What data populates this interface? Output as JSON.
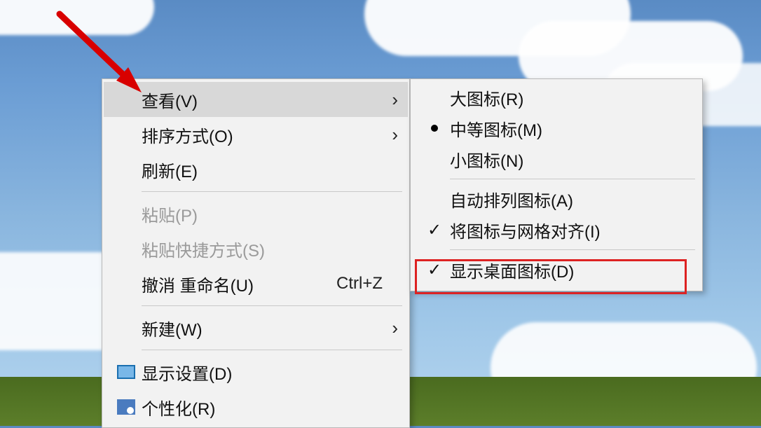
{
  "contextMenu": {
    "view": {
      "label": "查看(V)"
    },
    "sortBy": {
      "label": "排序方式(O)"
    },
    "refresh": {
      "label": "刷新(E)"
    },
    "paste": {
      "label": "粘贴(P)"
    },
    "pasteShortcut": {
      "label": "粘贴快捷方式(S)"
    },
    "undoRename": {
      "label": "撤消 重命名(U)",
      "shortcut": "Ctrl+Z"
    },
    "new": {
      "label": "新建(W)"
    },
    "displaySettings": {
      "label": "显示设置(D)"
    },
    "personalize": {
      "label": "个性化(R)"
    }
  },
  "viewSubmenu": {
    "largeIcons": {
      "label": "大图标(R)"
    },
    "mediumIcons": {
      "label": "中等图标(M)"
    },
    "smallIcons": {
      "label": "小图标(N)"
    },
    "autoArrange": {
      "label": "自动排列图标(A)"
    },
    "alignToGrid": {
      "label": "将图标与网格对齐(I)"
    },
    "showDesktopIcons": {
      "label": "显示桌面图标(D)"
    }
  }
}
